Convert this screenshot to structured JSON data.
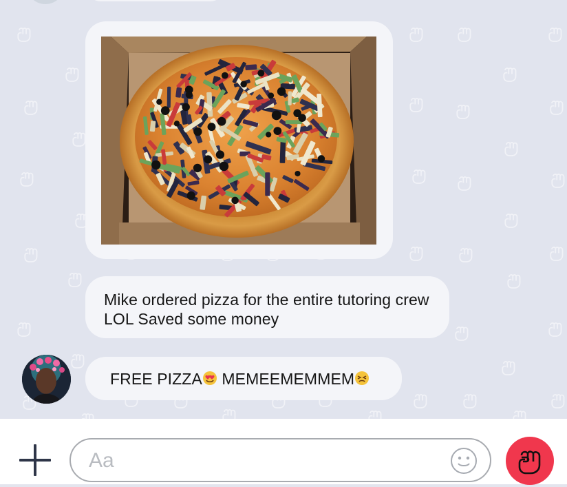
{
  "conversation": {
    "messages": [
      {
        "type": "image",
        "image_label": "pizza-photo"
      },
      {
        "type": "text",
        "text": "Mike ordered pizza for the entire tutoring crew LOL Saved some money"
      },
      {
        "type": "text",
        "text_part_1": "FREE PIZZA",
        "emoji_1": "heart-eyes-emoji",
        "text_part_2": " MEMEEMEMMEM",
        "emoji_2": "persevering-face-emoji"
      }
    ]
  },
  "composer": {
    "input_placeholder": "Aa",
    "input_value": "",
    "plus_icon": "plus-icon",
    "emoji_icon": "smiley-icon",
    "send_icon": "fist-icon"
  },
  "theme": {
    "chat_background": "#e1e4ee",
    "bubble_background": "#f4f5f9",
    "send_button_color": "#f0374d",
    "icon_color": "#2e3548"
  }
}
